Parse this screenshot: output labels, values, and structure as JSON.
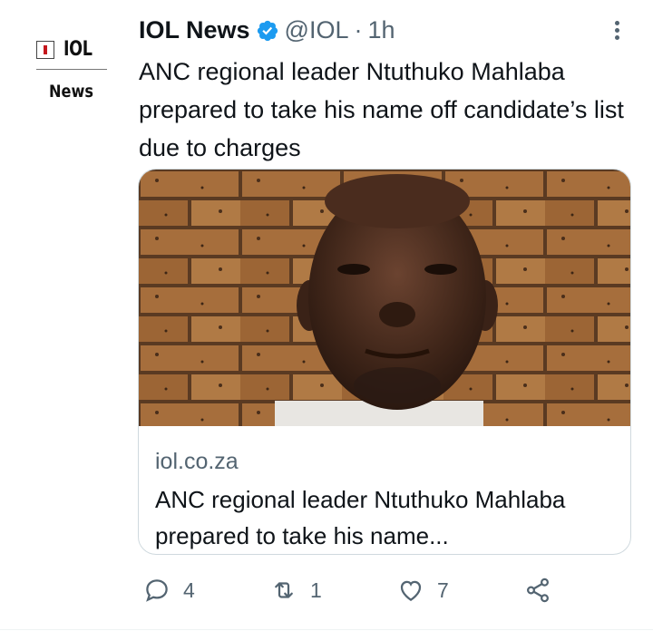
{
  "author": {
    "display_name": "IOL News",
    "handle": "@IOL",
    "separator": "·",
    "time": "1h",
    "avatar_logo_text": "IOL",
    "avatar_logo_subtext": "News",
    "verified_color": "#1d9bf0"
  },
  "tweet": {
    "text": "ANC regional leader Ntuthuko Mahlaba prepared to take his name off candidate’s list due to charges"
  },
  "link_card": {
    "domain": "iol.co.za",
    "title": "ANC regional leader Ntuthuko Mahlaba prepared to take his name...",
    "image_icon": "portrait-photo"
  },
  "actions": {
    "reply_count": "4",
    "retweet_count": "1",
    "like_count": "7",
    "icons": [
      "reply-icon",
      "retweet-icon",
      "like-icon",
      "share-icon"
    ]
  },
  "colors": {
    "text_primary": "#0f1419",
    "text_secondary": "#536471",
    "card_border": "#cfd9de"
  }
}
